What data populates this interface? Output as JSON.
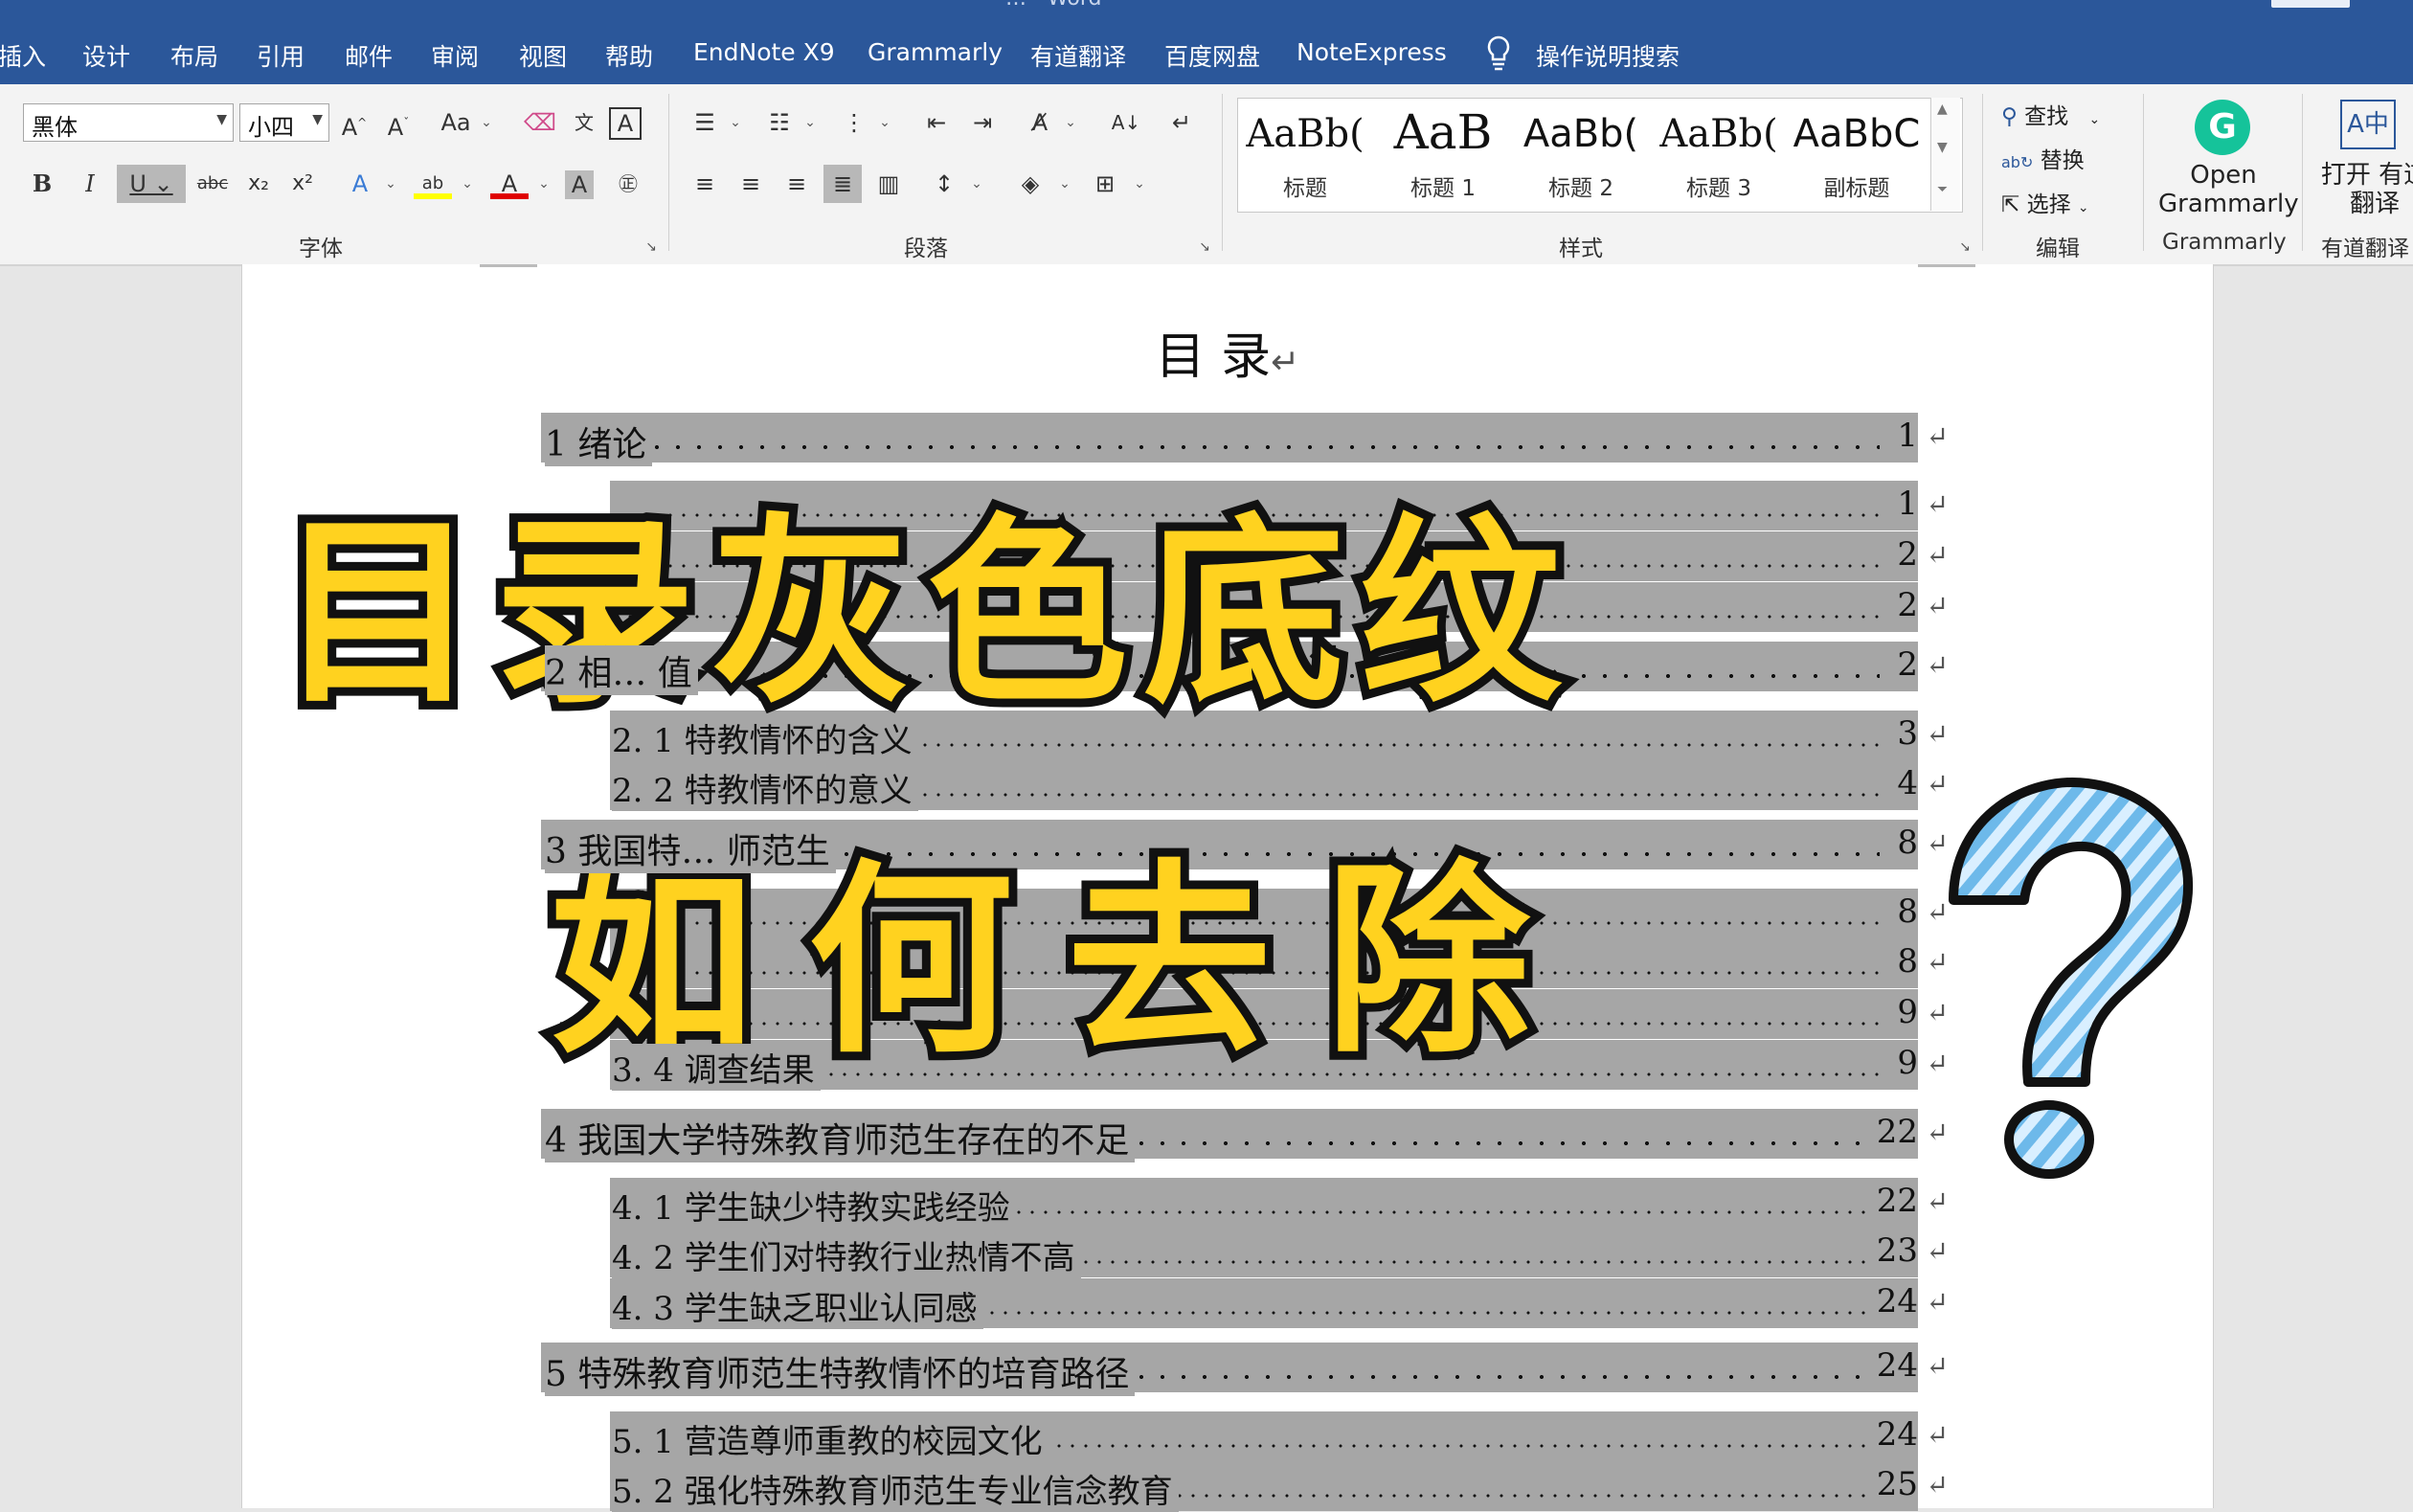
{
  "tabs": [
    "插入",
    "设计",
    "布局",
    "引用",
    "邮件",
    "审阅",
    "视图",
    "帮助",
    "EndNote X9",
    "Grammarly",
    "有道翻译",
    "百度网盘",
    "NoteExpress"
  ],
  "tell_me": "操作说明搜索",
  "title_fragment": "…  -  Word",
  "font": {
    "name": "黑体",
    "size": "小四",
    "group_label": "字体"
  },
  "paragraph": {
    "group_label": "段落"
  },
  "styles": {
    "group_label": "样式",
    "items": [
      {
        "preview": "AaBb(",
        "name": "标题"
      },
      {
        "preview": "AaB",
        "name": "标题 1"
      },
      {
        "preview": "AaBb(",
        "name": "标题 2"
      },
      {
        "preview": "AaBb(",
        "name": "标题 3"
      },
      {
        "preview": "AaBbC",
        "name": "副标题"
      }
    ]
  },
  "editing": {
    "find": "查找",
    "replace": "替换",
    "select": "选择",
    "group_label": "编辑"
  },
  "grammarly": {
    "button": "Open Grammarly",
    "group_label": "Grammarly"
  },
  "youdao": {
    "button": "打开 有道翻译",
    "group_label": "有道翻译"
  },
  "document": {
    "toc_title": "目 录",
    "lines": [
      {
        "text": "1 绪论",
        "page": "1",
        "level": 1
      },
      {
        "text": "",
        "page": "1",
        "level": 2
      },
      {
        "text": "",
        "page": "2",
        "level": 2
      },
      {
        "text": "",
        "page": "2",
        "level": 2
      },
      {
        "text": "2 相… 值",
        "page": "2",
        "level": 1
      },
      {
        "text": "2. 1 特教情怀的含义",
        "page": "3",
        "level": 2
      },
      {
        "text": "2. 2 特教情怀的意义",
        "page": "4",
        "level": 2
      },
      {
        "text": "3 我国特… 师范生",
        "page": "8",
        "level": 1
      },
      {
        "text": "",
        "page": "8",
        "level": 2
      },
      {
        "text": "",
        "page": "8",
        "level": 2
      },
      {
        "text": "",
        "page": "9",
        "level": 2
      },
      {
        "text": "3. 4 调查结果",
        "page": "9",
        "level": 2
      },
      {
        "text": "4  我国大学特殊教育师范生存在的不足",
        "page": "22",
        "level": 1
      },
      {
        "text": "4. 1 学生缺少特教实践经验",
        "page": "22",
        "level": 2
      },
      {
        "text": "4. 2 学生们对特教行业热情不高",
        "page": "23",
        "level": 2
      },
      {
        "text": "4. 3 学生缺乏职业认同感",
        "page": "24",
        "level": 2
      },
      {
        "text": "5 特殊教育师范生特教情怀的培育路径",
        "page": "24",
        "level": 1
      },
      {
        "text": "5. 1 营造尊师重教的校园文化",
        "page": "24",
        "level": 2
      },
      {
        "text": "5. 2 强化特殊教育师范生专业信念教育",
        "page": "25",
        "level": 2
      }
    ]
  },
  "overlay": {
    "line1": "目录灰色底纹",
    "line2": "如何去除"
  },
  "colors": {
    "word_blue": "#2b579a",
    "shading_gray": "#a6a6a6",
    "overlay_yellow": "#ffd21f",
    "question_blue": "#7cc4f0"
  }
}
